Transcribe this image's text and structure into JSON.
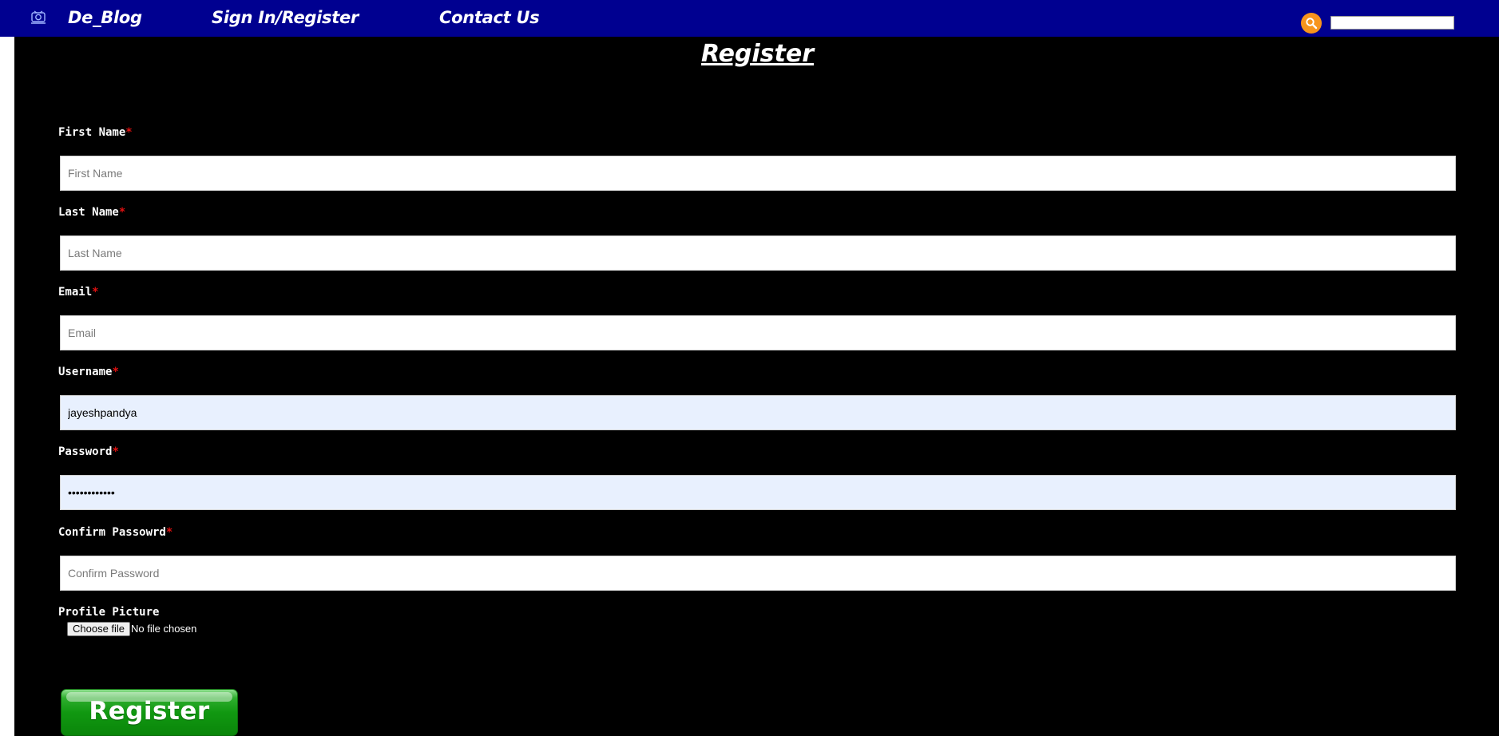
{
  "nav": {
    "brand": "De_Blog",
    "links": [
      "Sign In/Register",
      "Contact Us"
    ],
    "search_icon": "search-icon",
    "search_button_color": "#f7941d",
    "bar_color": "#000090"
  },
  "page": {
    "title": "Register"
  },
  "form": {
    "required_marker": "*",
    "fields": [
      {
        "label": "First Name",
        "placeholder": "First Name",
        "value": ""
      },
      {
        "label": "Last Name",
        "placeholder": "Last Name",
        "value": ""
      },
      {
        "label": "Email",
        "placeholder": "Email",
        "value": ""
      },
      {
        "label": "Username",
        "placeholder": "",
        "value": "jayeshpandya"
      },
      {
        "label": "Password",
        "placeholder": "",
        "value": "••••••••••••"
      },
      {
        "label": "Confirm Passowrd",
        "placeholder": "Confirm Password",
        "value": ""
      }
    ],
    "profile_picture": {
      "label": "Profile Picture",
      "button": "Choose file",
      "status": "No file chosen"
    },
    "submit_label": "Register",
    "submit_color": "#119811"
  }
}
